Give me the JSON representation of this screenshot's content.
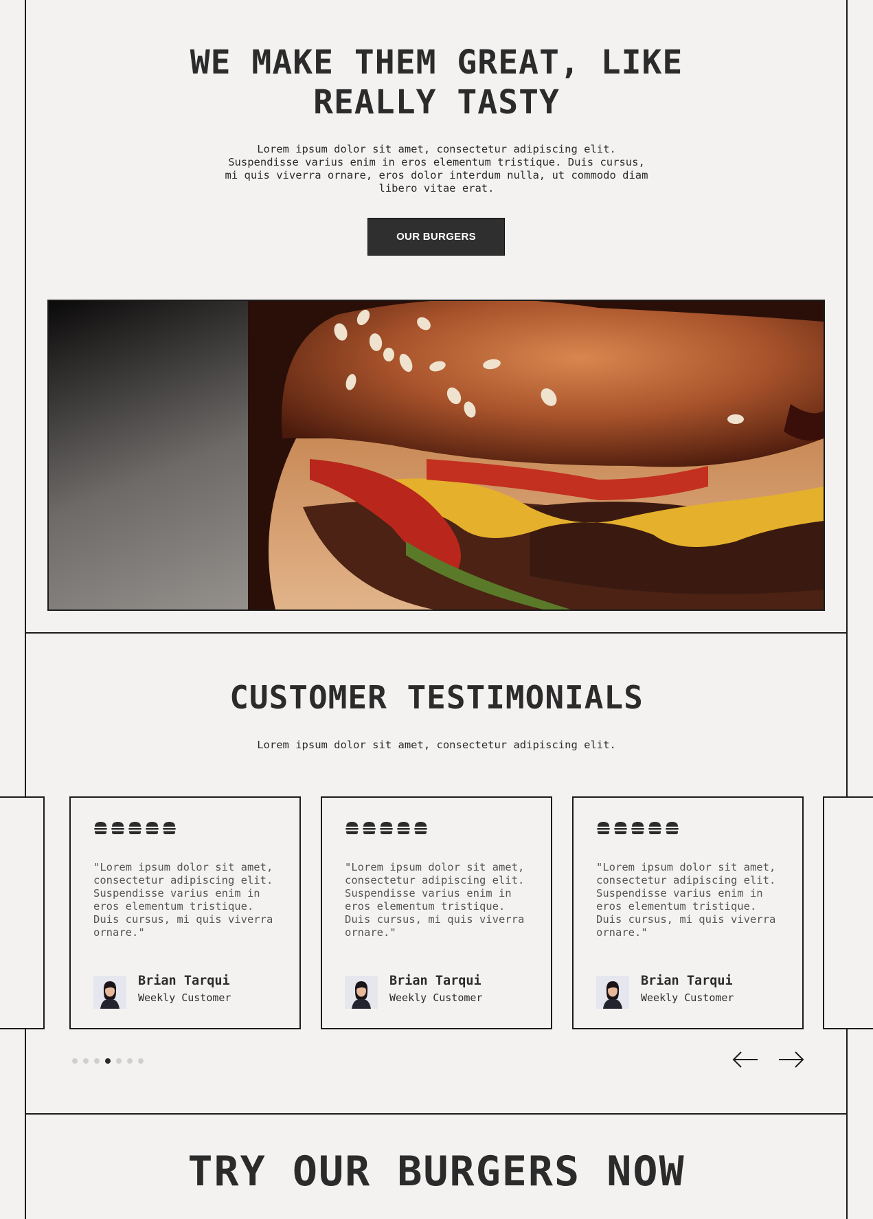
{
  "hero": {
    "title_line1": "WE MAKE THEM GREAT, LIKE",
    "title_line2": "REALLY TASTY",
    "description": "Lorem ipsum dolor sit amet, consectetur adipiscing elit. Suspendisse varius enim in eros elementum tristique. Duis cursus, mi quis viverra ornare, eros dolor interdum nulla, ut commodo diam libero vitae erat.",
    "button_label": "OUR BURGERS"
  },
  "testimonials": {
    "title": "CUSTOMER TESTIMONIALS",
    "subtitle": "Lorem ipsum dolor sit amet, consectetur adipiscing elit.",
    "rating": 5,
    "items": [
      {
        "quote": "\"Lorem ipsum dolor sit amet, consectetur adipiscing elit. Suspendisse varius enim in eros elementum tristique. Duis cursus, mi quis viverra ornare.\"",
        "name": "Brian Tarqui",
        "role": "Weekly Customer"
      },
      {
        "quote": "\"Lorem ipsum dolor sit amet, consectetur adipiscing elit. Suspendisse varius enim in eros elementum tristique. Duis cursus, mi quis viverra ornare.\"",
        "name": "Brian Tarqui",
        "role": "Weekly Customer"
      },
      {
        "quote": "\"Lorem ipsum dolor sit amet, consectetur adipiscing elit. Suspendisse varius enim in eros elementum tristique. Duis cursus, mi quis viverra ornare.\"",
        "name": "Brian Tarqui",
        "role": "Weekly Customer"
      }
    ],
    "pagination": {
      "total": 7,
      "active": 4
    }
  },
  "cta": {
    "title": "TRY OUR BURGERS NOW"
  },
  "icons": [
    "burger-rating-icon",
    "arrow-left-icon",
    "arrow-right-icon"
  ]
}
